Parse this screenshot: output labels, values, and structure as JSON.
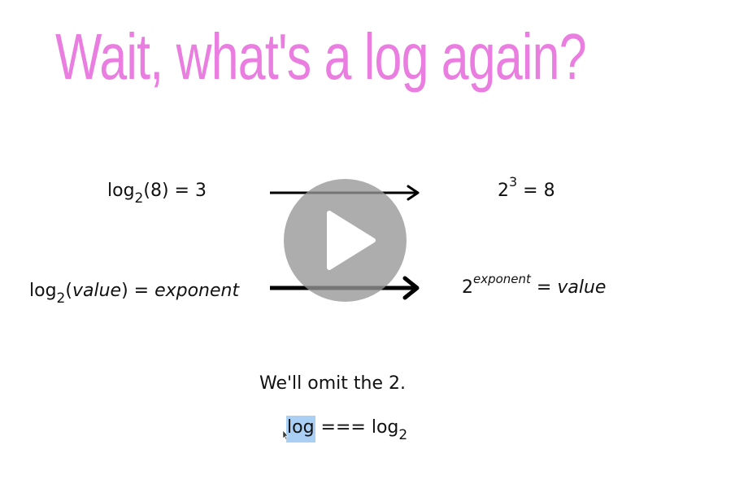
{
  "slide": {
    "title": "Wait, what's a log again?",
    "title_color": "#e97ee0"
  },
  "example": {
    "log_prefix": "log",
    "log_base": "2",
    "log_arg_rest": "(8) = 3",
    "exp_base": "2",
    "exp_power": "3",
    "exp_rest": " = 8"
  },
  "general": {
    "log_prefix": "log",
    "log_base": "2",
    "open_paren": "(",
    "value_word": "value",
    "close_eq": ") = ",
    "exponent_word": "exponent",
    "exp_base": "2",
    "exp_power": "exponent",
    "exp_eq": " = ",
    "exp_value": "value"
  },
  "note": {
    "text": "We'll omit the 2."
  },
  "equivalence": {
    "highlighted": "log",
    "rest": " === log",
    "base": "2",
    "highlight_color": "#a9cff5"
  },
  "player": {
    "play_icon": "play-icon",
    "button_color": "#969696"
  }
}
